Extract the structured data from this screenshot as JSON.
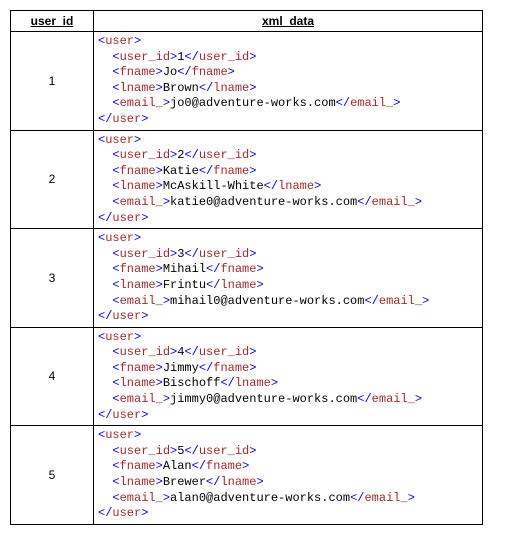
{
  "headers": {
    "col1": "user_id",
    "col2": "xml_data"
  },
  "rows": [
    {
      "user_id": "1",
      "fname": "Jo",
      "lname": "Brown",
      "email": "jo0@adventure-works.com"
    },
    {
      "user_id": "2",
      "fname": "Katie",
      "lname": "McAskill-White",
      "email": "katie0@adventure-works.com"
    },
    {
      "user_id": "3",
      "fname": "Mihail",
      "lname": "Frintu",
      "email": "mihail0@adventure-works.com"
    },
    {
      "user_id": "4",
      "fname": "Jimmy",
      "lname": "Bischoff",
      "email": "jimmy0@adventure-works.com"
    },
    {
      "user_id": "5",
      "fname": "Alan",
      "lname": "Brewer",
      "email": "alan0@adventure-works.com"
    }
  ],
  "chart_data": {
    "type": "table",
    "columns": [
      "user_id",
      "xml_data"
    ],
    "rows_count": 5
  }
}
